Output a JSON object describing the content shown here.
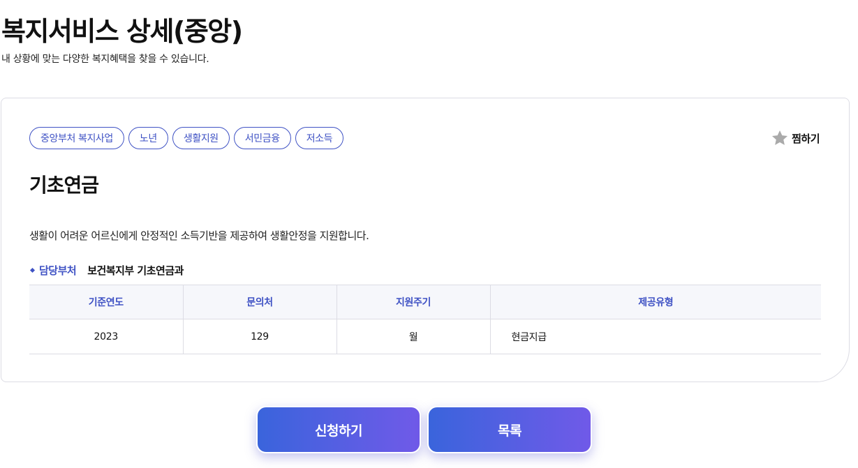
{
  "header": {
    "title": "복지서비스 상세(중앙)",
    "subtitle": "내 상황에 맞는 다양한 복지혜택을 찾을 수 있습니다."
  },
  "tags": [
    "중앙부처 복지사업",
    "노년",
    "생활지원",
    "서민금융",
    "저소득"
  ],
  "favorite": {
    "label": "찜하기",
    "icon": "star-icon",
    "color": "#aaaaaa"
  },
  "service": {
    "name": "기초연금",
    "description": "생활이 어려운 어르신에게 안정적인 소득기반을 제공하여 생활안정을 지원합니다.",
    "department_label": "담당부처",
    "department": "보건복지부 기초연금과"
  },
  "table": {
    "headers": [
      "기준연도",
      "문의처",
      "지원주기",
      "제공유형"
    ],
    "row": [
      "2023",
      "129",
      "월",
      "현금지급"
    ]
  },
  "buttons": {
    "apply": "신청하기",
    "list": "목록"
  },
  "colors": {
    "accent": "#3f52c4",
    "button_start": "#3a64dc",
    "button_end": "#705ae8"
  }
}
